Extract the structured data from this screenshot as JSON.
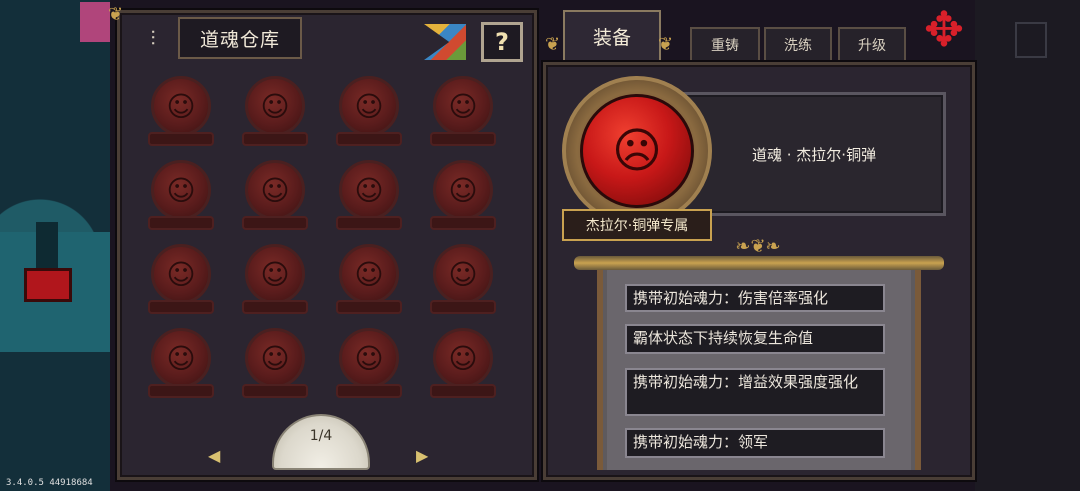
{
  "left_panel": {
    "title": "道魂仓库",
    "help_label": "?",
    "orbs": [
      {
        "glyph": "☺"
      },
      {
        "glyph": "☺"
      },
      {
        "glyph": "☺"
      },
      {
        "glyph": "☺"
      },
      {
        "glyph": "☺"
      },
      {
        "glyph": "☺"
      },
      {
        "glyph": "☺"
      },
      {
        "glyph": "☺"
      },
      {
        "glyph": "☺"
      },
      {
        "glyph": "☺"
      },
      {
        "glyph": "☺"
      },
      {
        "glyph": "☺"
      },
      {
        "glyph": "☺"
      },
      {
        "glyph": "☺"
      },
      {
        "glyph": "☺"
      },
      {
        "glyph": "☺"
      }
    ],
    "page_indicator": "1/4",
    "prev_arrow": "◀",
    "next_arrow": "▶"
  },
  "tabs": [
    {
      "label": "装备",
      "active": true
    },
    {
      "label": "重铸",
      "active": false
    },
    {
      "label": "洗练",
      "active": false
    },
    {
      "label": "升级",
      "active": false
    }
  ],
  "detail": {
    "soul_name": "道魂 · 杰拉尔·铜弹",
    "exclusive_label": "杰拉尔·铜弹专属",
    "attributes": [
      "携带初始魂力：伤害倍率强化",
      "霸体状态下持续恢复生命值",
      "携带初始魂力：增益效果强度强化",
      "携带初始魂力：领军"
    ]
  },
  "version": "3.4.0.5 44918684",
  "colors": {
    "panel_bg": "#2b2530",
    "orb_red": "#c81818",
    "gold": "#c9a250"
  }
}
